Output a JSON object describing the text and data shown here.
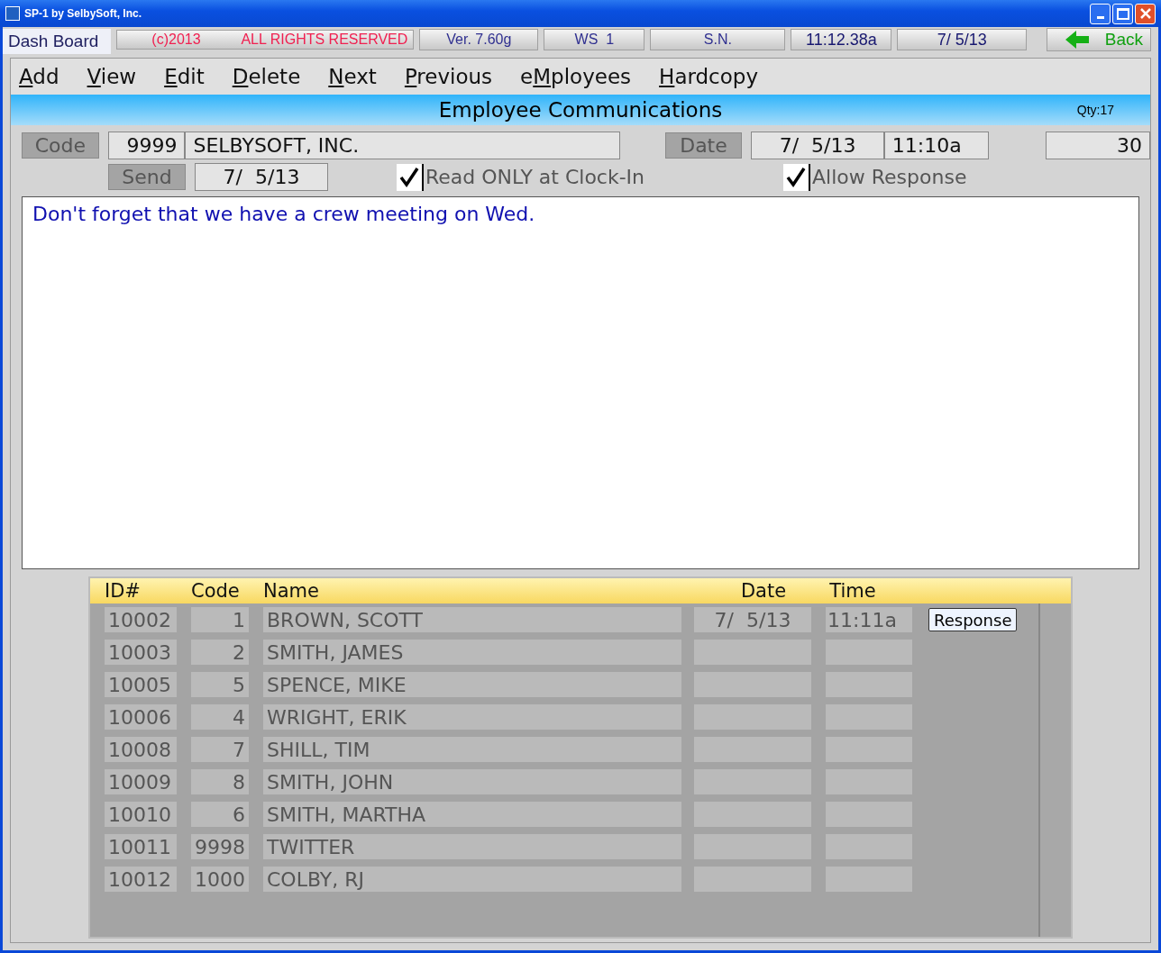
{
  "window": {
    "title": "SP-1 by SelbySoft, Inc."
  },
  "status_bar": {
    "tab": "Dash Board",
    "copyright": "(c)2013",
    "rights": "ALL RIGHTS RESERVED",
    "version": "Ver. 7.60g",
    "workstation": "WS  1",
    "serial": "S.N.",
    "clock": "11:12.38a",
    "date": "7/ 5/13",
    "back": "Back"
  },
  "menu": [
    {
      "key": "A",
      "after": "dd"
    },
    {
      "key": "V",
      "after": "iew"
    },
    {
      "key": "E",
      "after": "dit"
    },
    {
      "key": "D",
      "after": "elete"
    },
    {
      "key": "N",
      "after": "ext"
    },
    {
      "key": "P",
      "after": "revious"
    },
    {
      "before": "e",
      "key": "M",
      "after": "ployees"
    },
    {
      "key": "H",
      "after": "ardcopy"
    }
  ],
  "header": {
    "title": "Employee Communications",
    "qty": "Qty:17"
  },
  "form": {
    "code_label": "Code",
    "code": "9999",
    "company": "SELBYSOFT, INC.",
    "date_label": "Date",
    "date": "7/  5/13",
    "time": "11:10a",
    "days": "30",
    "send_label": "Send",
    "send_date": "7/  5/13",
    "read_only": {
      "label": "Read ONLY at Clock-In",
      "checked": true
    },
    "allow_response": {
      "label": "Allow Response",
      "checked": true
    }
  },
  "message": "Don't forget that we have a crew meeting on Wed.",
  "table": {
    "columns": [
      "ID#",
      "Code",
      "Name",
      "Date",
      "Time"
    ],
    "rows": [
      {
        "id": "10002",
        "code": "1",
        "name": "BROWN, SCOTT",
        "date": "7/  5/13",
        "time": "11:11a",
        "action": "Response"
      },
      {
        "id": "10003",
        "code": "2",
        "name": "SMITH, JAMES"
      },
      {
        "id": "10005",
        "code": "5",
        "name": "SPENCE, MIKE"
      },
      {
        "id": "10006",
        "code": "4",
        "name": "WRIGHT, ERIK"
      },
      {
        "id": "10008",
        "code": "7",
        "name": "SHILL, TIM"
      },
      {
        "id": "10009",
        "code": "8",
        "name": "SMITH, JOHN"
      },
      {
        "id": "10010",
        "code": "6",
        "name": "SMITH, MARTHA"
      },
      {
        "id": "10011",
        "code": "9998",
        "name": "TWITTER"
      },
      {
        "id": "10012",
        "code": "1000",
        "name": "COLBY, RJ"
      }
    ]
  }
}
